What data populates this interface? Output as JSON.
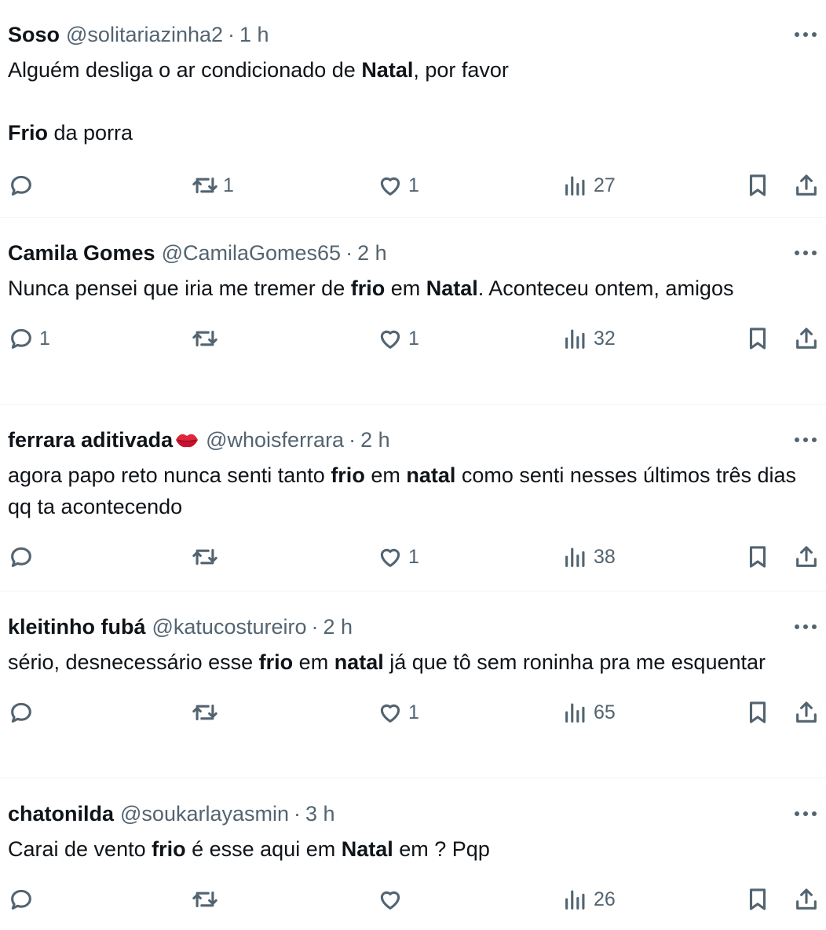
{
  "tweets": [
    {
      "name": "Soso",
      "handle": "@solitariazinha2",
      "sep": "·",
      "time": "1 h",
      "body": [
        {
          "t": "Alguém desliga o ar condicionado de "
        },
        {
          "t": "Natal",
          "b": true
        },
        {
          "t": ", por favor\n\n"
        },
        {
          "t": "Frio",
          "b": true
        },
        {
          "t": " da porra"
        }
      ],
      "replies": "",
      "retweets": "1",
      "likes": "1",
      "views": "27"
    },
    {
      "name": "Camila Gomes",
      "handle": "@CamilaGomes65",
      "sep": "·",
      "time": "2 h",
      "body": [
        {
          "t": "Nunca pensei que iria me tremer de "
        },
        {
          "t": "frio",
          "b": true
        },
        {
          "t": " em "
        },
        {
          "t": "Natal",
          "b": true
        },
        {
          "t": ". Aconteceu ontem, amigos"
        }
      ],
      "replies": "1",
      "retweets": "",
      "likes": "1",
      "views": "32"
    },
    {
      "name": "ferrara aditivada",
      "name_emoji": "kiss-mark-emoji",
      "handle": "@whoisferrara",
      "sep": "·",
      "time": "2 h",
      "body": [
        {
          "t": "agora papo reto nunca senti tanto "
        },
        {
          "t": "frio",
          "b": true
        },
        {
          "t": " em "
        },
        {
          "t": "natal",
          "b": true
        },
        {
          "t": " como senti nesses últimos três dias qq ta acontecendo"
        }
      ],
      "replies": "",
      "retweets": "",
      "likes": "1",
      "views": "38"
    },
    {
      "name": "kleitinho fubá",
      "handle": "@katucostureiro",
      "sep": "·",
      "time": "2 h",
      "body": [
        {
          "t": "sério, desnecessário esse "
        },
        {
          "t": "frio",
          "b": true
        },
        {
          "t": " em "
        },
        {
          "t": "natal",
          "b": true
        },
        {
          "t": " já que tô sem roninha pra me esquentar"
        }
      ],
      "replies": "",
      "retweets": "",
      "likes": "1",
      "views": "65"
    },
    {
      "name": "chatonilda",
      "handle": "@soukarlayasmin",
      "sep": "·",
      "time": "3 h",
      "body": [
        {
          "t": "Carai de vento "
        },
        {
          "t": "frio",
          "b": true
        },
        {
          "t": " é esse aqui em "
        },
        {
          "t": "Natal",
          "b": true
        },
        {
          "t": " em ? Pqp"
        }
      ],
      "replies": "",
      "retweets": "",
      "likes": "",
      "views": "26"
    }
  ],
  "icons": {
    "more": "more-options-icon",
    "reply": "reply-icon",
    "retweet": "retweet-icon",
    "like": "heart-icon",
    "views": "views-chart-icon",
    "bookmark": "bookmark-icon",
    "share": "share-icon"
  },
  "colors": {
    "text": "#0f1419",
    "secondary": "#536471",
    "divider": "#eff3f4"
  }
}
